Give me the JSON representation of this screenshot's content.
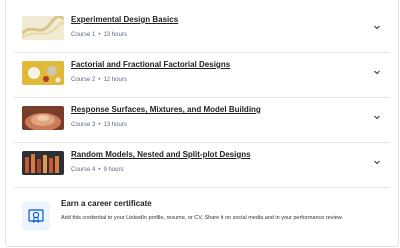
{
  "courses": [
    {
      "title": "Experimental Design Basics",
      "course_no": "Course 1",
      "duration": "13 hours"
    },
    {
      "title": "Factorial and Fractional Factorial Designs",
      "course_no": "Course 2",
      "duration": "12 hours"
    },
    {
      "title": "Response Surfaces, Mixtures, and Model Building",
      "course_no": "Course 3",
      "duration": "13 hours"
    },
    {
      "title": "Random Models, Nested and Split-plot Designs",
      "course_no": "Course 4",
      "duration": "9 hours"
    }
  ],
  "certificate": {
    "title": "Earn a career certificate",
    "description": "Add this credential to your LinkedIn profile, resume, or CV. Share it on social media and in your performance review."
  },
  "icons": {
    "expand": "chevron-down-icon",
    "certificate": "certificate-icon"
  },
  "colors": {
    "meta_text": "#5b6780",
    "accent": "#0056d2",
    "icon_bg": "#edf4ff"
  }
}
